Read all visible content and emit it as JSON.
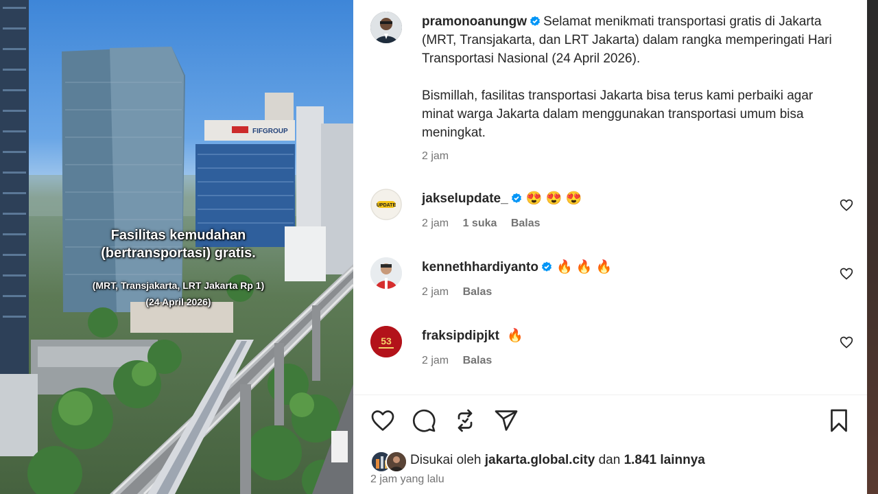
{
  "media": {
    "caption_line1": "Fasilitas kemudahan",
    "caption_line2": "(bertransportasi) gratis.",
    "caption_line3": "(MRT, Transjakarta, LRT Jakarta Rp 1)",
    "caption_line4": "(24 April 2026)",
    "building_sign": "FIFGROUP"
  },
  "post": {
    "author": "pramonoanungw",
    "caption_para1": "Selamat menikmati transportasi gratis di Jakarta (MRT, Transjakarta, dan LRT Jakarta) dalam rangka memperingati Hari Transportasi Nasional (24 April 2026).",
    "caption_para2": "Bismillah, fasilitas transportasi Jakarta bisa terus kami perbaiki agar minat warga Jakarta dalam menggunakan transportasi umum bisa meningkat.",
    "time": "2 jam"
  },
  "comments": [
    {
      "username": "jakselupdate_",
      "emoji": "😍 😍 😍",
      "time": "2 jam",
      "likes": "1 suka",
      "reply": "Balas",
      "avatar_text": "UPDATE"
    },
    {
      "username": "kennethhardiyanto",
      "emoji": "🔥 🔥 🔥",
      "time": "2 jam",
      "reply": "Balas"
    },
    {
      "username": "fraksipdipjkt",
      "emoji": "🔥",
      "time": "2 jam",
      "reply": "Balas",
      "avatar_text": "53"
    }
  ],
  "actions": {
    "like": "heart-icon",
    "comment": "comment-icon",
    "repost": "repost-icon",
    "share": "send-icon",
    "save": "bookmark-icon"
  },
  "likes": {
    "prefix": "Disukai oleh",
    "user": "jakarta.global.city",
    "connector": "dan",
    "count": "1.841 lainnya"
  },
  "timeago": "2 jam yang lalu",
  "colors": {
    "verified": "#0095f6",
    "text": "#262626",
    "secondary": "#737373"
  }
}
